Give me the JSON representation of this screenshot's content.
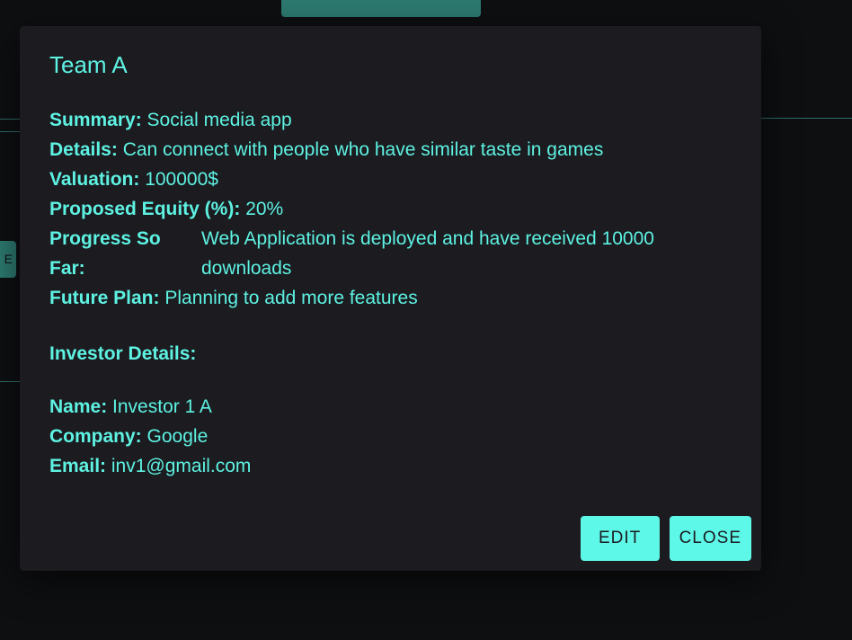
{
  "background": {
    "side_button_label": "E"
  },
  "modal": {
    "title": "Team A",
    "fields": [
      {
        "label": "Summary:",
        "value": "Social media app"
      },
      {
        "label": "Details:",
        "value": "Can connect with people who have similar taste in games"
      },
      {
        "label": "Valuation:",
        "value": "100000$"
      },
      {
        "label": "Proposed Equity (%):",
        "value": "20%"
      },
      {
        "label": "Progress So Far:",
        "value": "Web Application is deployed and have received 10000 downloads"
      },
      {
        "label": "Future Plan:",
        "value": "Planning to add more features"
      }
    ],
    "investor_section_title": "Investor Details:",
    "investor": [
      {
        "label": "Name:",
        "value": "Investor 1 A"
      },
      {
        "label": "Company:",
        "value": "Google"
      },
      {
        "label": "Email:",
        "value": "inv1@gmail.com"
      }
    ],
    "buttons": {
      "edit": "EDIT",
      "close": "CLOSE"
    }
  },
  "colors": {
    "accent": "#5ef2e2",
    "button_bg": "#5ef8e8",
    "modal_bg": "#1b1b20",
    "page_bg": "#0e0f11",
    "muted_teal": "#2d7a70"
  }
}
